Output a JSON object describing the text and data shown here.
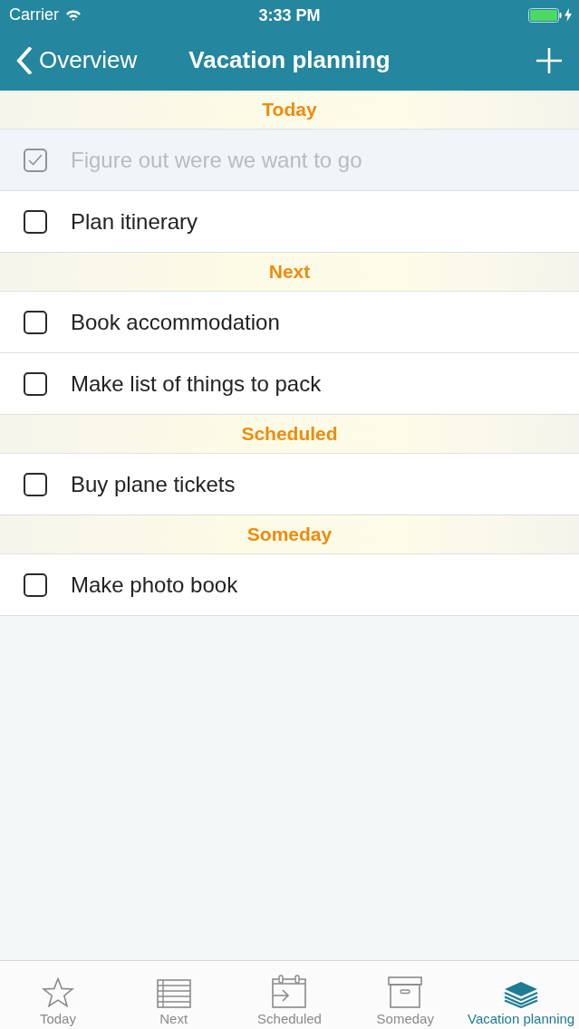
{
  "status_bar": {
    "carrier": "Carrier",
    "time": "3:33 PM"
  },
  "nav_bar": {
    "back_label": "Overview",
    "title": "Vacation planning"
  },
  "sections": [
    {
      "title": "Today",
      "tasks": [
        {
          "text": "Figure out were we want to go",
          "checked": true
        },
        {
          "text": "Plan itinerary",
          "checked": false
        }
      ]
    },
    {
      "title": "Next",
      "tasks": [
        {
          "text": "Book accommodation",
          "checked": false
        },
        {
          "text": "Make list of things to pack",
          "checked": false
        }
      ]
    },
    {
      "title": "Scheduled",
      "tasks": [
        {
          "text": "Buy plane tickets",
          "checked": false
        }
      ]
    },
    {
      "title": "Someday",
      "tasks": [
        {
          "text": "Make photo book",
          "checked": false
        }
      ]
    }
  ],
  "tab_bar": [
    {
      "label": "Today",
      "kind": "star",
      "selected": false
    },
    {
      "label": "Next",
      "kind": "list",
      "selected": false
    },
    {
      "label": "Scheduled",
      "kind": "calendar",
      "selected": false
    },
    {
      "label": "Someday",
      "kind": "box",
      "selected": false
    },
    {
      "label": "Vacation planning",
      "kind": "layers",
      "selected": true
    }
  ]
}
